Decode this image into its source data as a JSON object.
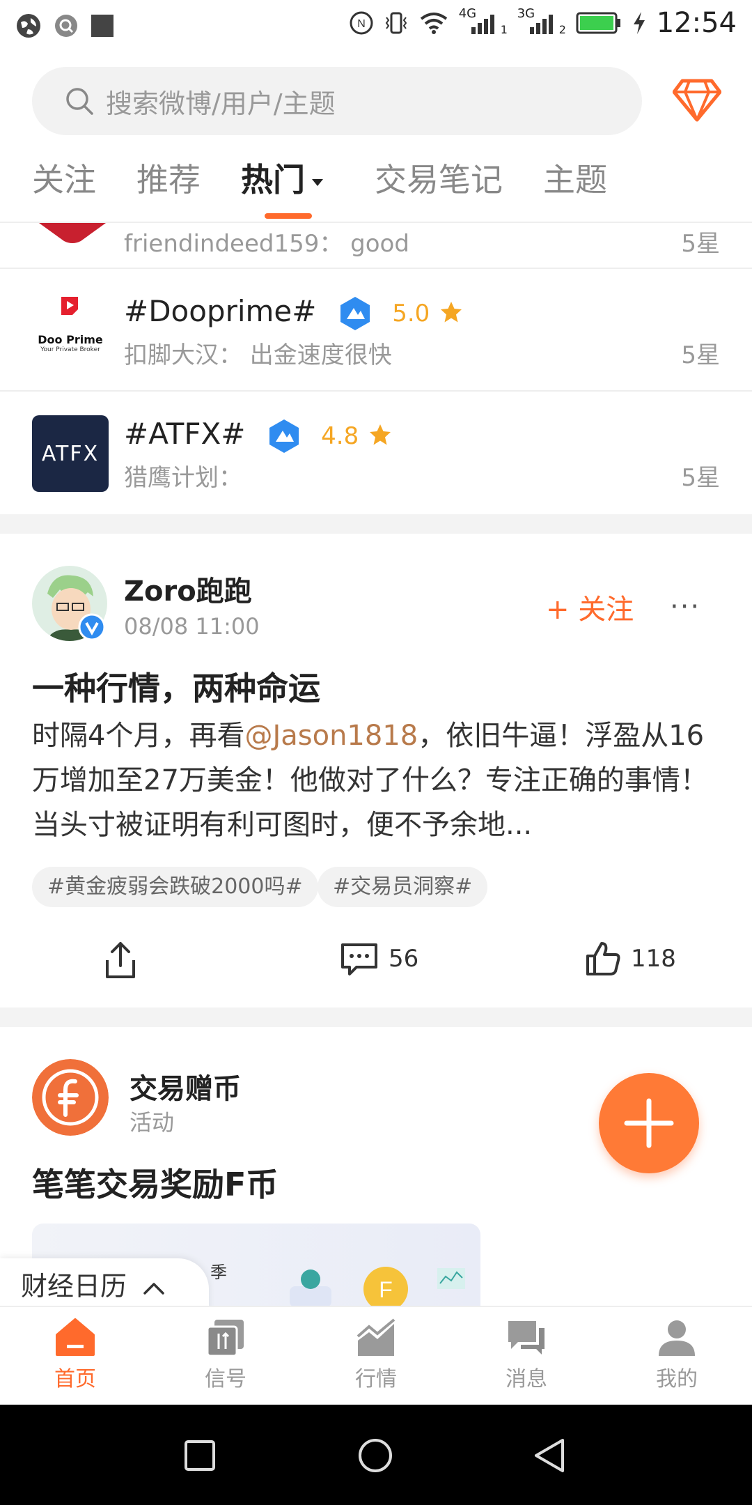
{
  "status_bar": {
    "time": "12:54",
    "network_1": "4G",
    "network_2": "3G",
    "sim_1": "1",
    "sim_2": "2",
    "nfc": "N"
  },
  "header": {
    "search_placeholder": "搜索微博/用户/主题",
    "tabs": [
      {
        "label": "关注",
        "active": false
      },
      {
        "label": "推荐",
        "active": false
      },
      {
        "label": "热门",
        "active": true
      },
      {
        "label": "交易笔记",
        "active": false
      },
      {
        "label": "主题",
        "active": false
      }
    ]
  },
  "brokers": [
    {
      "sub": "friendindeed159：  good",
      "stars": "5星"
    },
    {
      "name": "#Dooprime#",
      "rating": "5.0",
      "sub": "扣脚大汉：  出金速度很快",
      "stars": "5星",
      "logo_text": "Doo Prime",
      "logo_tagline": "Your Private Broker"
    },
    {
      "name": "#ATFX#",
      "rating": "4.8",
      "sub": "猎鹰计划：",
      "stars": "5星",
      "logo_text": "ATFX"
    }
  ],
  "post": {
    "author": "Zoro跑跑",
    "time": "08/08 11:00",
    "follow_label": "关注",
    "more_label": "···",
    "title": "一种行情，两种命运",
    "body_pre": "时隔4个月，再看",
    "mention": "@Jason1818",
    "body_post": "，依旧牛逼！浮盈从16万增加至27万美金！他做对了什么？专注正确的事情！当头寸被证明有利可图时，便不予余地...",
    "tags": [
      "#黄金疲弱会跌破2000吗#",
      "#交易员洞察#"
    ],
    "comments": "56",
    "likes": "118"
  },
  "activity": {
    "name": "交易赠币",
    "sub": "活动",
    "title": "笔笔交易奖励F币",
    "banner_text": "季"
  },
  "calendar": {
    "label": "财经日历"
  },
  "bottom_nav": [
    {
      "label": "首页",
      "active": true
    },
    {
      "label": "信号",
      "active": false
    },
    {
      "label": "行情",
      "active": false
    },
    {
      "label": "消息",
      "active": false
    },
    {
      "label": "我的",
      "active": false
    }
  ],
  "colors": {
    "accent": "#ff6a2c",
    "rating": "#f5a623",
    "verified": "#2f8cf0"
  }
}
